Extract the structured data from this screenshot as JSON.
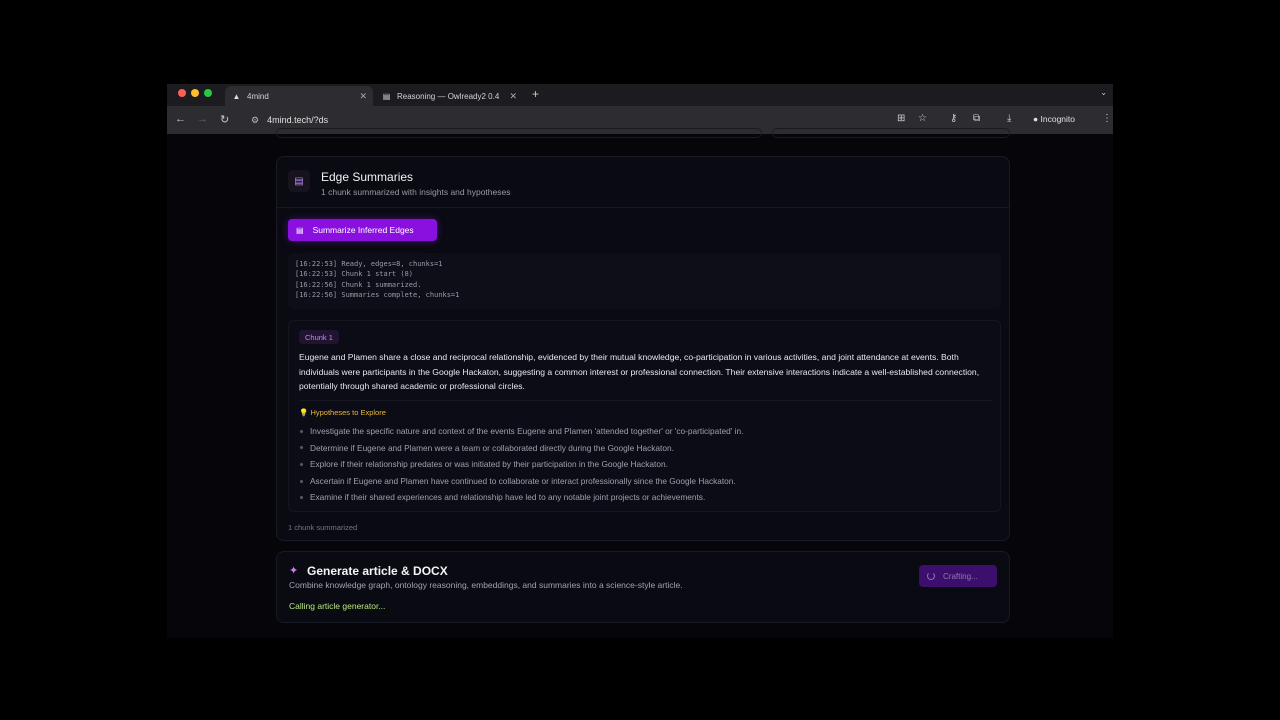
{
  "browser": {
    "tabs": [
      {
        "title": "4mind",
        "active": true
      },
      {
        "title": "Reasoning — Owlready2 0.4",
        "active": false
      }
    ],
    "url": "4mind.tech/?ds",
    "incognito_label": "Incognito"
  },
  "edge_summaries": {
    "title": "Edge Summaries",
    "subtitle": "1 chunk summarized with insights and hypotheses",
    "button_label": "Summarize Inferred Edges",
    "log": [
      "[16:22:53] Ready, edges=8, chunks=1",
      "[16:22:53] Chunk 1 start (8)",
      "[16:22:56] Chunk 1 summarized.",
      "[16:22:56] Summaries complete, chunks=1"
    ],
    "chunk": {
      "label": "Chunk 1",
      "summary": "Eugene and Plamen share a close and reciprocal relationship, evidenced by their mutual knowledge, co-participation in various activities, and joint attendance at events. Both individuals were participants in the Google Hackaton, suggesting a common interest or professional connection. Their extensive interactions indicate a well-established connection, potentially through shared academic or professional circles.",
      "hypotheses_title": "Hypotheses to Explore",
      "hypotheses": [
        "Investigate the specific nature and context of the events Eugene and Plamen 'attended together' or 'co-participated' in.",
        "Determine if Eugene and Plamen were a team or collaborated directly during the Google Hackaton.",
        "Explore if their relationship predates or was initiated by their participation in the Google Hackaton.",
        "Ascertain if Eugene and Plamen have continued to collaborate or interact professionally since the Google Hackaton.",
        "Examine if their shared experiences and relationship have led to any notable joint projects or achievements."
      ]
    },
    "footer": "1 chunk summarized"
  },
  "generate": {
    "title": "Generate article & DOCX",
    "subtitle": "Combine knowledge graph, ontology reasoning, embeddings, and summaries into a science-style article.",
    "status": "Calling article generator...",
    "button_label": "Crafting..."
  },
  "colors": {
    "accent": "#8a10e0",
    "hypotheses": "#e9b93a",
    "status": "#b7ea7c"
  }
}
